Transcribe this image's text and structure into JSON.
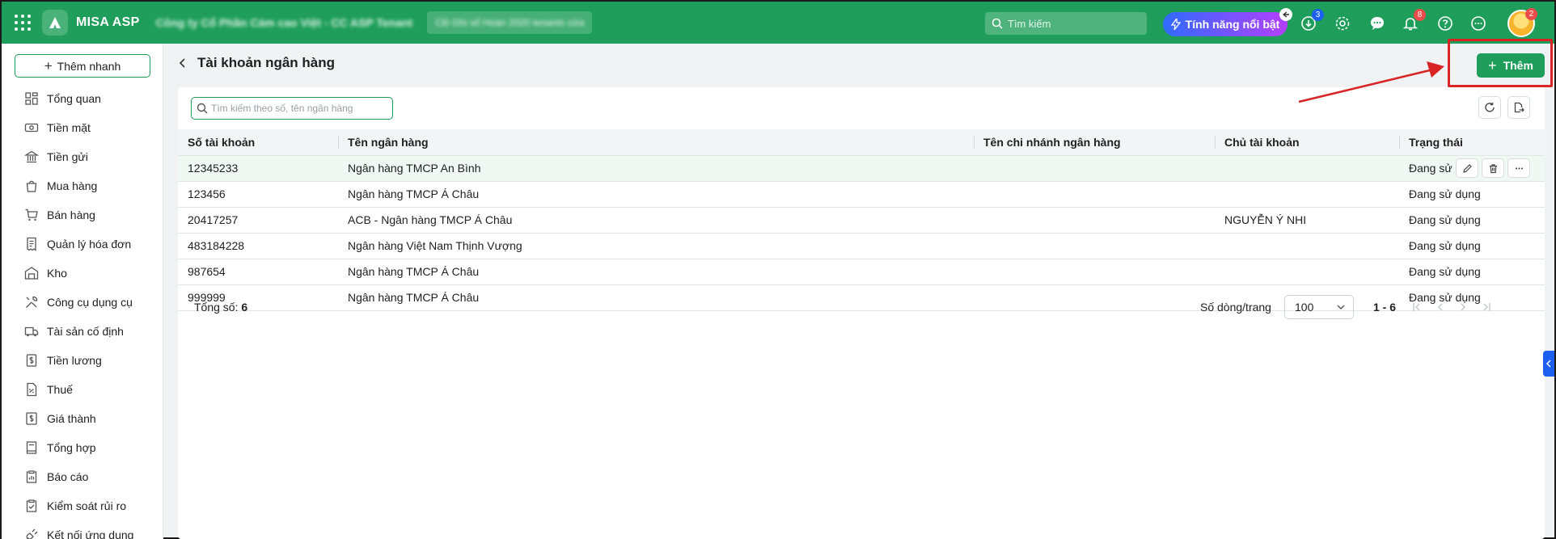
{
  "header": {
    "brand": "MISA ASP",
    "company": "Công ty Cổ Phần Cám cao Việt - CC ASP Tenant",
    "period": "CĐ Ghi sổ Hoàn 2020 tenants cửa",
    "search_placeholder": "Tìm kiếm",
    "feature_label": "Tính năng nổi bật",
    "download_badge": "3",
    "notification_badge": "8",
    "avatar_badge": "2"
  },
  "sidebar": {
    "quick_add": "Thêm nhanh",
    "items": [
      {
        "label": "Tổng quan",
        "icon": "dashboard-icon"
      },
      {
        "label": "Tiền mặt",
        "icon": "cash-icon"
      },
      {
        "label": "Tiền gửi",
        "icon": "bank-icon"
      },
      {
        "label": "Mua hàng",
        "icon": "shopping-bag-icon"
      },
      {
        "label": "Bán hàng",
        "icon": "cart-icon"
      },
      {
        "label": "Quản lý hóa đơn",
        "icon": "invoice-icon"
      },
      {
        "label": "Kho",
        "icon": "warehouse-icon"
      },
      {
        "label": "Công cụ dụng cụ",
        "icon": "tools-icon"
      },
      {
        "label": "Tài sản cố định",
        "icon": "truck-icon"
      },
      {
        "label": "Tiền lương",
        "icon": "payroll-icon"
      },
      {
        "label": "Thuế",
        "icon": "tax-icon"
      },
      {
        "label": "Giá thành",
        "icon": "cost-icon"
      },
      {
        "label": "Tổng hợp",
        "icon": "book-icon"
      },
      {
        "label": "Báo cáo",
        "icon": "report-icon"
      },
      {
        "label": "Kiểm soát rủi ro",
        "icon": "checklist-icon"
      },
      {
        "label": "Kết nối ứng dụng",
        "icon": "plug-icon"
      }
    ]
  },
  "page": {
    "title": "Tài khoản ngân hàng",
    "add_label": "Thêm",
    "search_placeholder": "Tìm kiếm theo số, tên ngân hàng"
  },
  "table": {
    "columns": [
      "Số tài khoản",
      "Tên ngân hàng",
      "Tên chi nhánh ngân hàng",
      "Chủ tài khoản",
      "Trạng thái"
    ],
    "rows": [
      [
        "12345233",
        "Ngân hàng TMCP An Bình",
        "",
        "",
        "Đang sử dụng"
      ],
      [
        "123456",
        "Ngân hàng TMCP Á Châu",
        "",
        "",
        "Đang sử dụng"
      ],
      [
        "20417257",
        "ACB - Ngân hàng TMCP Á Châu",
        "",
        "NGUYỄN Ý NHI",
        "Đang sử dụng"
      ],
      [
        "483184228",
        "Ngân hàng Việt Nam Thịnh Vượng",
        "",
        "",
        "Đang sử dụng"
      ],
      [
        "987654",
        "Ngân hàng TMCP Á Châu",
        "",
        "",
        "Đang sử dụng"
      ],
      [
        "999999",
        "Ngân hàng TMCP Á Châu",
        "",
        "",
        "Đang sử dụng"
      ]
    ],
    "hover_row_status": "Đang sử"
  },
  "footer": {
    "total_label": "Tổng số:",
    "total_value": "6",
    "rows_per_page_label": "Số dòng/trang",
    "rows_per_page": "100",
    "range": "1 - 6"
  },
  "colors": {
    "brand_green": "#1e9e5a",
    "annotation_red": "#d82424",
    "accent_blue": "#1d5ff0"
  }
}
